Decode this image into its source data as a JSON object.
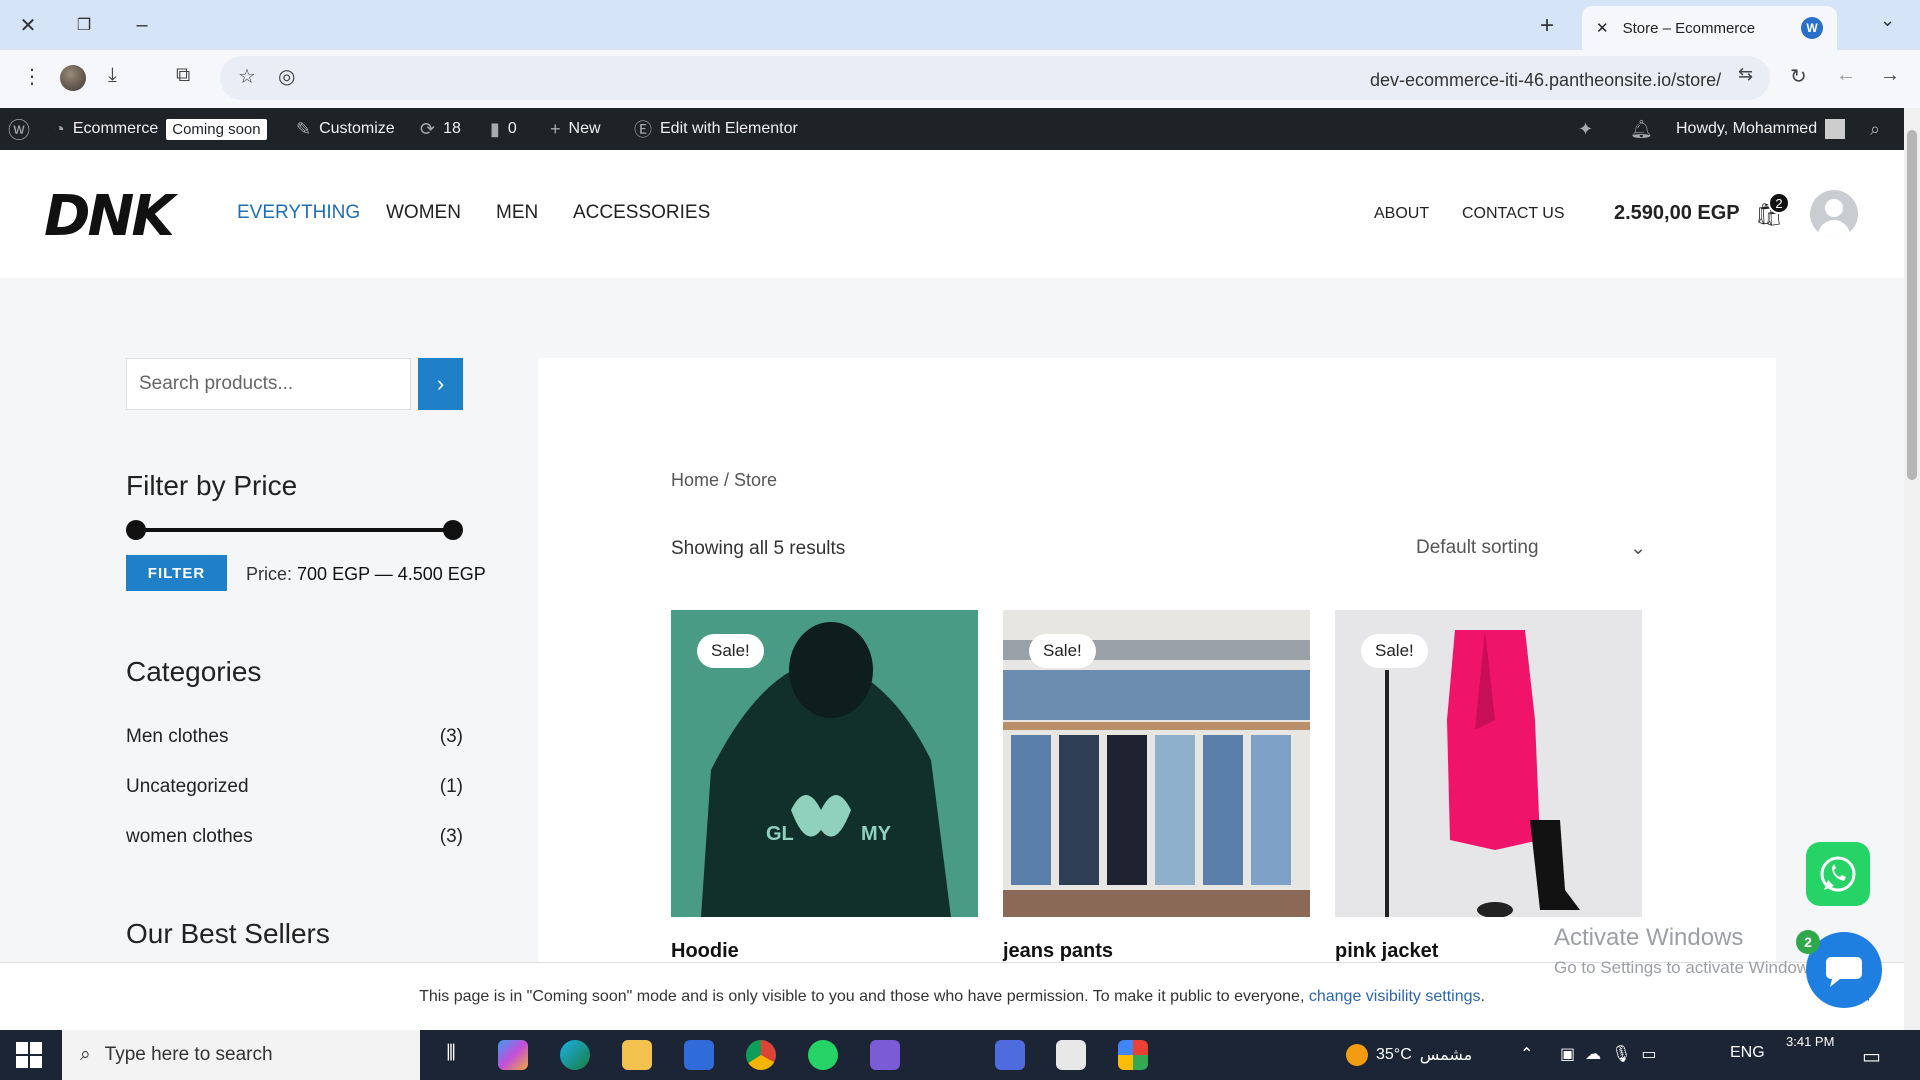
{
  "browser": {
    "tab_title": "Store – Ecommerce",
    "url": "dev-ecommerce-iti-46.pantheonsite.io/store/"
  },
  "adminbar": {
    "site": "Ecommerce",
    "coming_soon": "Coming soon",
    "customize": "Customize",
    "updates": "18",
    "comments": "0",
    "new": "New",
    "elementor": "Edit with Elementor",
    "howdy": "Howdy, Mohammed"
  },
  "header": {
    "logo": "DNK",
    "nav": [
      "EVERYTHING",
      "WOMEN",
      "MEN",
      "ACCESSORIES"
    ],
    "right_nav": [
      "ABOUT",
      "CONTACT US"
    ],
    "cart_total": "2.590,00 EGP",
    "cart_count": "2"
  },
  "sidebar": {
    "search_placeholder": "Search products...",
    "filter_title": "Filter by Price",
    "filter_button": "FILTER",
    "price_label": "Price:",
    "price_range": "700 EGP — 4.500 EGP",
    "categories_title": "Categories",
    "categories": [
      {
        "name": "Men clothes",
        "count": "(3)"
      },
      {
        "name": "Uncategorized",
        "count": "(1)"
      },
      {
        "name": "women clothes",
        "count": "(3)"
      }
    ],
    "best_sellers_title": "Our Best Sellers"
  },
  "main": {
    "breadcrumb": "Home / Store",
    "results": "Showing all 5 results",
    "sorting": "Default sorting",
    "sale_badge": "Sale!",
    "products": [
      {
        "title": "Hoodie"
      },
      {
        "title": "jeans pants"
      },
      {
        "title": "pink jacket"
      }
    ]
  },
  "notice": {
    "text": "This page is in \"Coming soon\" mode and is only visible to you and those who have permission. To make it public to everyone,",
    "link": "change visibility settings",
    "end": "."
  },
  "watermark": {
    "line1": "Activate Windows",
    "line2": "Go to Settings to activate Windows."
  },
  "chat_badge": "2",
  "taskbar": {
    "search": "Type here to search",
    "weather": "35°C",
    "weather_text": "مشمس",
    "lang": "ENG",
    "time": "3:41 PM"
  }
}
